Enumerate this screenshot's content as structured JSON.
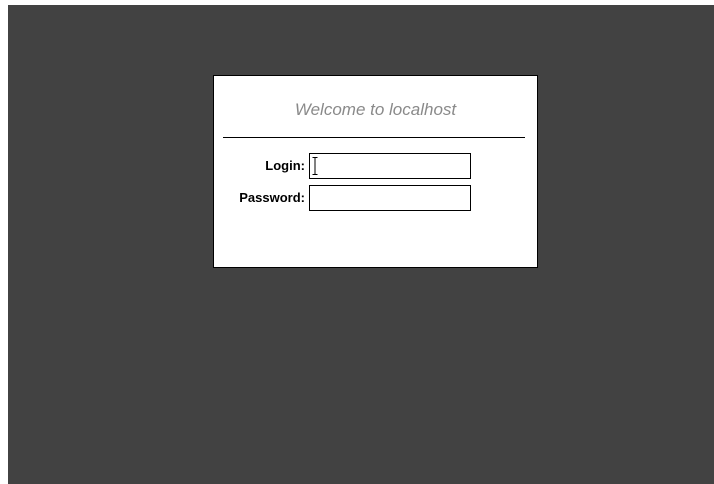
{
  "dialog": {
    "title": "Welcome to localhost",
    "login_label": "Login:",
    "login_value": "",
    "password_label": "Password:",
    "password_value": ""
  },
  "colors": {
    "background": "#424242",
    "dialog": "#ffffff",
    "title_text": "#8a8a8a"
  },
  "icons": {
    "cursor": "i-beam-cursor-icon"
  }
}
